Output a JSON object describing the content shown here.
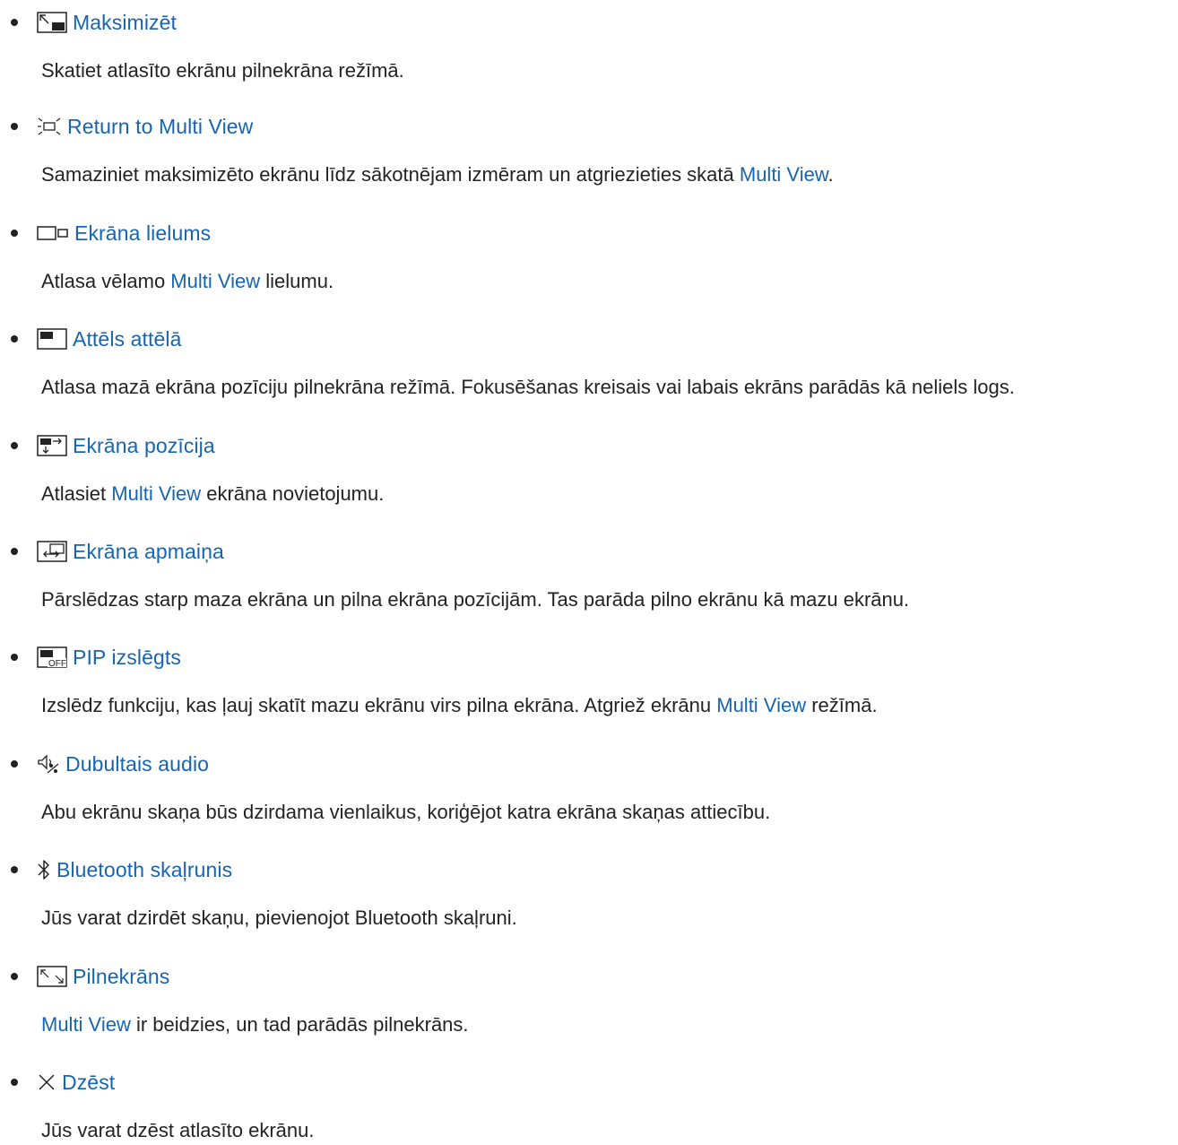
{
  "items": [
    {
      "icon": "maximize-icon",
      "title": "Maksimizēt",
      "desc": "Skatiet atlasīto ekrānu pilnekrāna režīmā."
    },
    {
      "icon": "return-multiview-icon",
      "title": "Return to Multi View",
      "desc_a": "Samaziniet maksimizēto ekrānu līdz sākotnējam izmēram un atgriezieties skatā ",
      "link": "Multi View",
      "desc_b": "."
    },
    {
      "icon": "screen-size-icon",
      "title": "Ekrāna lielums",
      "desc_a": "Atlasa vēlamo ",
      "link": "Multi View",
      "desc_b": " lielumu."
    },
    {
      "icon": "picture-in-picture-icon",
      "title": "Attēls attēlā",
      "desc": "Atlasa mazā ekrāna pozīciju pilnekrāna režīmā. Fokusēšanas kreisais vai labais ekrāns parādās kā neliels logs."
    },
    {
      "icon": "screen-position-icon",
      "title": "Ekrāna pozīcija",
      "desc_a": "Atlasiet ",
      "link": "Multi View",
      "desc_b": " ekrāna novietojumu."
    },
    {
      "icon": "screen-swap-icon",
      "title": "Ekrāna apmaiņa",
      "desc": "Pārslēdzas starp maza ekrāna un pilna ekrāna pozīcijām. Tas parāda pilno ekrānu kā mazu ekrānu."
    },
    {
      "icon": "pip-off-icon",
      "icon_text": "OFF",
      "title": "PIP izslēgts",
      "desc_a": "Izslēdz funkciju, kas ļauj skatīt mazu ekrānu virs pilna ekrāna. Atgriež ekrānu ",
      "link": "Multi View",
      "desc_b": " režīmā."
    },
    {
      "icon": "dual-audio-icon",
      "title": "Dubultais audio",
      "desc": "Abu ekrānu skaņa būs dzirdama vienlaikus, koriģējot katra ekrāna skaņas attiecību."
    },
    {
      "icon": "bluetooth-icon",
      "title": "Bluetooth skaļrunis",
      "desc": "Jūs varat dzirdēt skaņu, pievienojot Bluetooth skaļruni."
    },
    {
      "icon": "full-screen-icon",
      "title": "Pilnekrāns",
      "desc_a": "",
      "link": "Multi View",
      "desc_b": " ir beidzies, un tad parādās pilnekrāns."
    },
    {
      "icon": "delete-icon",
      "title": "Dzēst",
      "desc": "Jūs varat dzēst atlasīto ekrānu."
    }
  ]
}
